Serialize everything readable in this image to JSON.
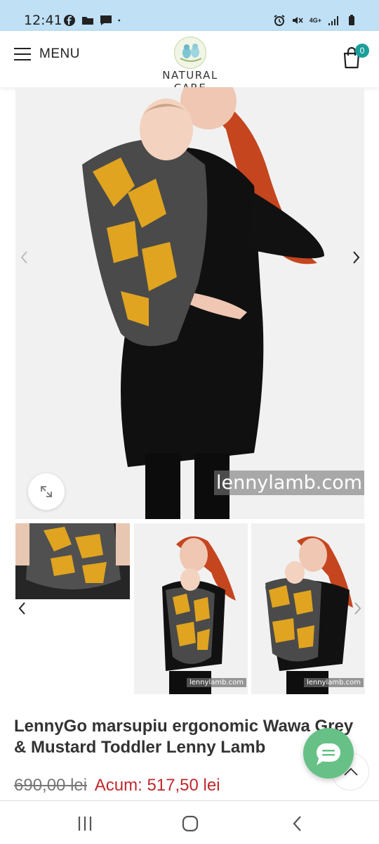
{
  "status_bar": {
    "time": "12:41",
    "network_label": "4G+"
  },
  "header": {
    "menu_label": "MENU",
    "logo_text": "NATURAL CARE",
    "cart_count": "0"
  },
  "gallery": {
    "main_watermark": "lennylamb.com",
    "thumb_watermark": "lennylamb.com"
  },
  "product": {
    "title": "LennyGo marsupiu ergonomic Wawa Grey & Mustard Toddler Lenny Lamb",
    "old_price": "690,00 lei",
    "new_price": "Acum: 517,50 lei"
  },
  "colors": {
    "accent_teal": "#1a9e9a",
    "price_red": "#c0282d",
    "chat_green": "#67c187",
    "status_bar_bg": "#bfe0f5"
  },
  "icons": {
    "menu": "hamburger-icon",
    "cart": "shopping-bag-icon",
    "zoom": "expand-icon",
    "chat": "chat-icon",
    "scroll_top": "chevron-up-icon",
    "nav_recents": "recents-icon",
    "nav_home": "home-icon",
    "nav_back": "back-icon"
  }
}
